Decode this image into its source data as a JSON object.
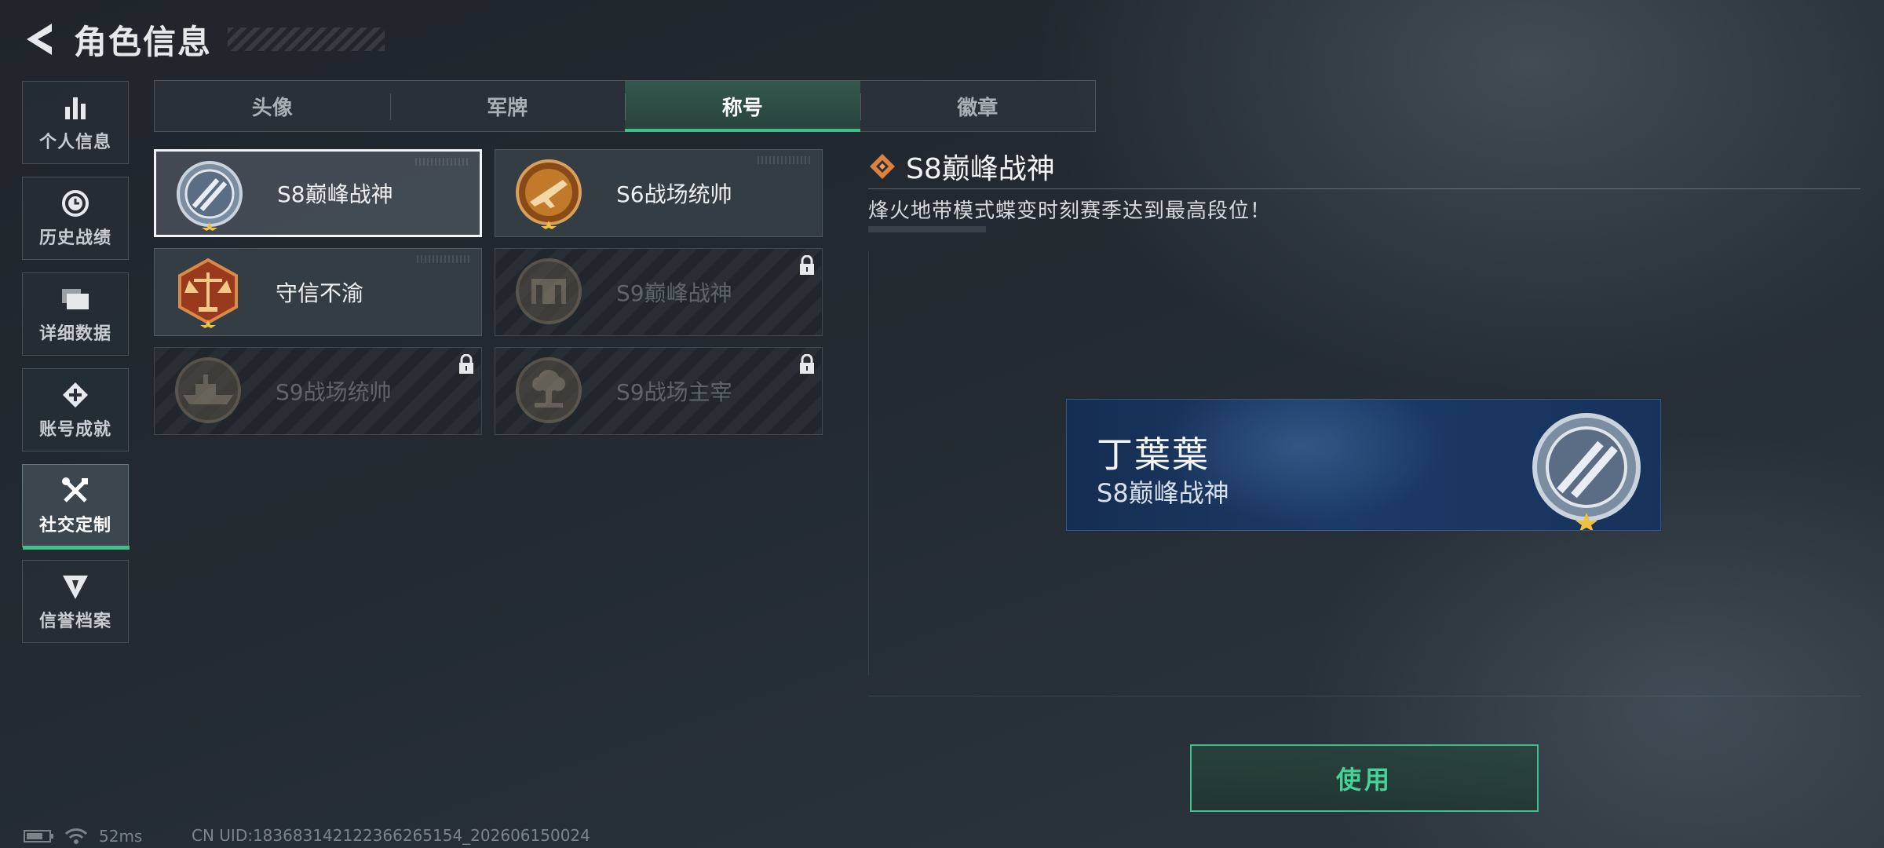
{
  "header": {
    "title": "角色信息"
  },
  "sidebar": {
    "items": [
      {
        "label": "个人信息",
        "icon": "bar-chart-icon"
      },
      {
        "label": "历史战绩",
        "icon": "clock-icon"
      },
      {
        "label": "详细数据",
        "icon": "folder-icon"
      },
      {
        "label": "账号成就",
        "icon": "achievement-icon"
      },
      {
        "label": "社交定制",
        "icon": "tools-icon",
        "active": true
      },
      {
        "label": "信誉档案",
        "icon": "credibility-icon"
      }
    ]
  },
  "tabs": [
    {
      "label": "头像"
    },
    {
      "label": "军牌"
    },
    {
      "label": "称号",
      "active": true
    },
    {
      "label": "徽章"
    }
  ],
  "titles": [
    {
      "name": "S8巅峰战神",
      "selected": true,
      "locked": false,
      "medal": "wings-medal-icon"
    },
    {
      "name": "S6战场统帅",
      "selected": false,
      "locked": false,
      "medal": "jet-medal-icon"
    },
    {
      "name": "守信不渝",
      "selected": false,
      "locked": false,
      "medal": "scales-medal-icon"
    },
    {
      "name": "S9巅峰战神",
      "selected": false,
      "locked": true,
      "medal": "fortress-medal-icon"
    },
    {
      "name": "S9战场统帅",
      "selected": false,
      "locked": true,
      "medal": "warship-medal-icon"
    },
    {
      "name": "S9战场主宰",
      "selected": false,
      "locked": true,
      "medal": "explosion-medal-icon"
    }
  ],
  "detail": {
    "title": "S8巅峰战神",
    "description": "烽火地带模式蝶变时刻赛季达到最高段位！"
  },
  "preview": {
    "player_name": "丁葉葉",
    "title": "S8巅峰战神"
  },
  "use_button": {
    "label": "使用"
  },
  "status": {
    "ping": "52ms",
    "uid": "CN UID:1836831421223662651​54_202606150024"
  },
  "colors": {
    "accent": "#3fbf8a",
    "use_text": "#46d39a",
    "plate_blue": "#1c3a66",
    "medal_gold": "#c07a2a",
    "medal_red": "#9a3a1c"
  }
}
